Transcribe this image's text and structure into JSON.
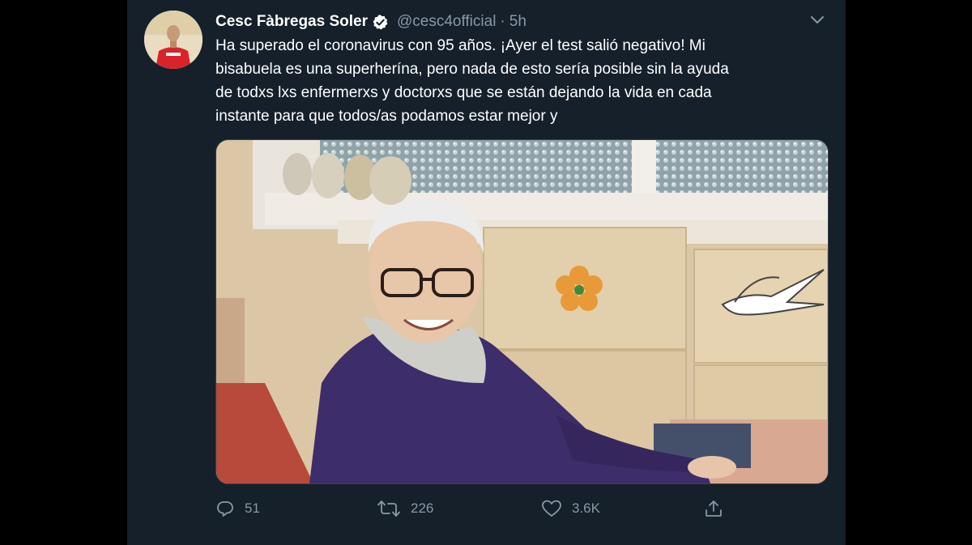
{
  "tweet": {
    "author": {
      "display_name": "Cesc Fàbregas Soler",
      "handle": "@cesc4official",
      "verified": true
    },
    "separator": "·",
    "time": "5h",
    "text_lines": [
      "Ha superado el coronavirus con 95 años. ¡Ayer el test salió negativo! Mi",
      "bisabuela es una superherína, pero nada de esto sería posible sin la ayuda",
      "de todxs lxs enfermerxs y doctorxs que se están dejando la vida en cada",
      "instante para que todos/as podamos estar mejor y"
    ],
    "media": {
      "kind": "photo"
    },
    "actions": {
      "reply": {
        "icon": "reply-icon",
        "count": "51"
      },
      "retweet": {
        "icon": "retweet-icon",
        "count": "226"
      },
      "like": {
        "icon": "heart-icon",
        "count": "3.6K"
      },
      "share": {
        "icon": "share-icon"
      }
    },
    "menu_icon": "chevron-down-icon"
  },
  "colors": {
    "page_background": "#000000",
    "card_background": "#15202b",
    "text_primary": "#ffffff",
    "text_secondary": "#8899a6",
    "verified_badge": "#ffffff"
  }
}
